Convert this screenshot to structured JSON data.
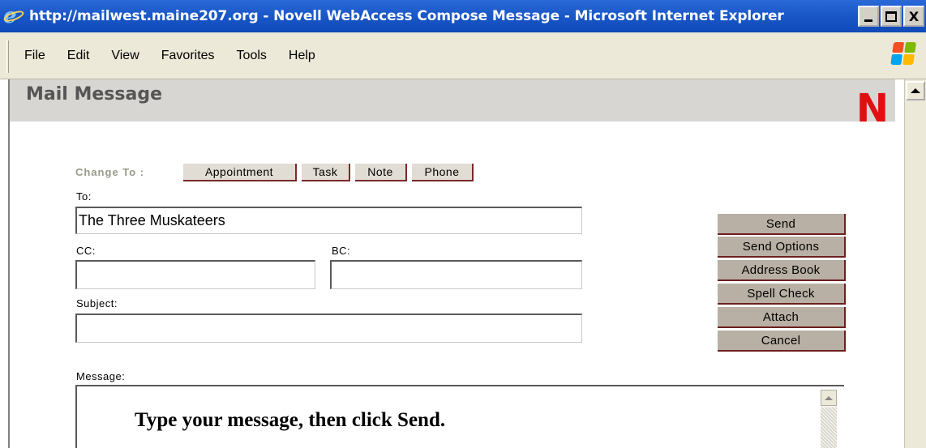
{
  "window": {
    "title": "http://mailwest.maine207.org - Novell WebAccess Compose Message - Microsoft Internet Explorer",
    "controls": {
      "minimize": "_",
      "maximize": "□",
      "close": "X"
    }
  },
  "menu": {
    "items": [
      {
        "label": "File"
      },
      {
        "label": "Edit"
      },
      {
        "label": "View"
      },
      {
        "label": "Favorites"
      },
      {
        "label": "Tools"
      },
      {
        "label": "Help"
      }
    ]
  },
  "header": {
    "title": "Mail Message",
    "logo": "N"
  },
  "change_to": {
    "label": "Change To :",
    "buttons": [
      "Appointment",
      "Task",
      "Note",
      "Phone"
    ]
  },
  "form": {
    "to_label": "To:",
    "to_value": "The Three Muskateers",
    "cc_label": "CC:",
    "cc_value": "",
    "bc_label": "BC:",
    "bc_value": "",
    "subject_label": "Subject:",
    "subject_value": "",
    "message_label": "Message:"
  },
  "actions": [
    "Send",
    "Send Options",
    "Address Book",
    "Spell Check",
    "Attach",
    "Cancel"
  ],
  "caption": "Type your message, then click Send.",
  "colors": {
    "titlebar": "#1b58c8",
    "novell_red": "#e01010",
    "button_face": "#b8b0a4",
    "button_shadow": "#6e1e1e"
  },
  "icons": [
    "ie-logo-icon",
    "windows-flag-icon",
    "scroll-up-arrow-icon"
  ]
}
